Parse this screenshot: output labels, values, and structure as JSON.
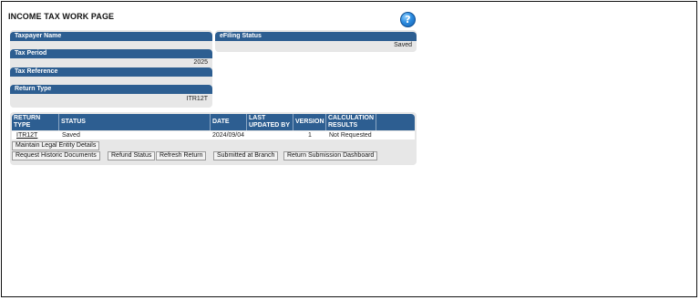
{
  "page": {
    "title": "INCOME TAX WORK PAGE"
  },
  "taxpayer_panel": {
    "taxpayer_name_label": "Taxpayer Name",
    "taxpayer_name_value": "",
    "tax_period_label": "Tax Period",
    "tax_period_value": "2025",
    "tax_reference_label": "Tax Reference",
    "tax_reference_value": "",
    "return_type_label": "Return Type",
    "return_type_value": "ITR12T"
  },
  "efiling_panel": {
    "label": "eFiling Status",
    "value": "Saved"
  },
  "returns_table": {
    "headers": {
      "return_type": "RETURN TYPE",
      "status": "STATUS",
      "date": "DATE",
      "last_updated_by": "LAST UPDATED BY",
      "version": "VERSION",
      "calculation_results": "CALCULATION RESULTS"
    },
    "rows": [
      {
        "return_type": "ITR12T",
        "status": "Saved",
        "date": "2024/09/04",
        "last_updated_by": "",
        "version": "1",
        "calculation_results": "Not Requested"
      }
    ]
  },
  "buttons": {
    "maintain_legal_entity": "Maintain Legal Entity Details",
    "request_historic_documents": "Request Historic Documents",
    "refund_status": "Refund Status",
    "refresh_return": "Refresh Return",
    "submitted_at_branch": "Submitted at Branch",
    "return_submission_dashboard": "Return Submission Dashboard"
  },
  "icons": {
    "help": "help-icon"
  },
  "colors": {
    "header_blue": "#2d5e91",
    "panel_grey": "#e7e7e7"
  }
}
